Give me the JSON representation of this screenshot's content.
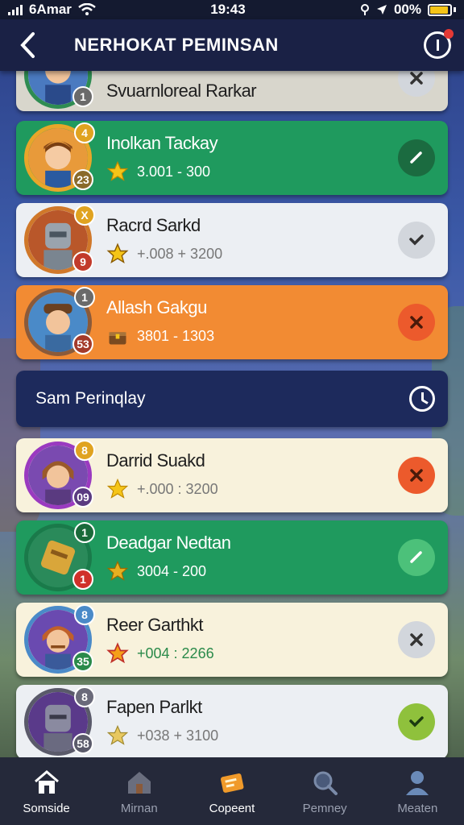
{
  "status": {
    "carrier": "6Amar",
    "time": "19:43",
    "battery": "00%"
  },
  "header": {
    "title": "NERHOKAT PEMINSAN"
  },
  "rows": [
    {
      "name": "Svuarnloreal Rarkar",
      "score": "",
      "badge_top": "",
      "badge_bottom": "1",
      "theme": "grayish",
      "action": "x"
    },
    {
      "name": "Inolkan Tackay",
      "score": "3.001 - 300",
      "badge_top": "4",
      "badge_bottom": "23",
      "theme": "green",
      "action": "check"
    },
    {
      "name": "Racrd Sarkd",
      "score": "+.008 + 3200",
      "badge_top": "X",
      "badge_bottom": "9",
      "theme": "white",
      "action": "check"
    },
    {
      "name": "Allash Gakgu",
      "score": "3801 - 1303",
      "badge_top": "1",
      "badge_bottom": "53",
      "theme": "orange",
      "action": "x"
    },
    {
      "name": "Darrid Suakd",
      "score": "+.000 : 3200",
      "badge_top": "8",
      "badge_bottom": "09",
      "theme": "cream",
      "action": "x"
    },
    {
      "name": "Deadgar Nedtan",
      "score": "3004 - 200",
      "badge_top": "1",
      "badge_bottom": "1",
      "theme": "green",
      "action": "check"
    },
    {
      "name": "Reer Garthkt",
      "score": "+004 : 2266",
      "badge_top": "8",
      "badge_bottom": "35",
      "theme": "cream",
      "action": "x"
    },
    {
      "name": "Fapen Parlkt",
      "score": "+038 + 3100",
      "badge_top": "8",
      "badge_bottom": "58",
      "theme": "white",
      "action": "check"
    }
  ],
  "section": {
    "title": "Sam Perinqlay"
  },
  "nav": [
    {
      "label": "Somside",
      "icon": "home-icon",
      "active": true
    },
    {
      "label": "Mirnan",
      "icon": "house-icon",
      "active": false
    },
    {
      "label": "Copeent",
      "icon": "ticket-icon",
      "active": true
    },
    {
      "label": "Pemney",
      "icon": "search-icon",
      "active": false
    },
    {
      "label": "Meaten",
      "icon": "profile-icon",
      "active": false
    }
  ],
  "colors": {
    "header_bg": "#1a2145",
    "green_row": "#1f9a5e",
    "orange_row": "#f28b33",
    "section_bg": "#1d2a5c",
    "nav_bg": "#25293a"
  }
}
